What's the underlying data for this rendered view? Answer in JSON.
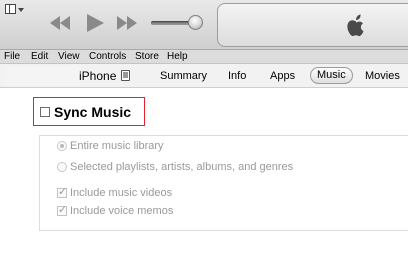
{
  "menu": {
    "items": [
      "File",
      "Edit",
      "View",
      "Controls",
      "Store",
      "Help"
    ]
  },
  "device": {
    "name": "iPhone",
    "icon": "iphone-icon"
  },
  "tabs": [
    {
      "label": "Summary",
      "active": false
    },
    {
      "label": "Info",
      "active": false
    },
    {
      "label": "Apps",
      "active": false
    },
    {
      "label": "Music",
      "active": true
    },
    {
      "label": "Movies",
      "active": false
    }
  ],
  "sync_music": {
    "label": "Sync Music",
    "checked": false
  },
  "library_options": [
    {
      "label": "Entire music library",
      "selected": true,
      "enabled": false
    },
    {
      "label": "Selected playlists, artists, albums, and genres",
      "selected": false,
      "enabled": false
    }
  ],
  "include_options": [
    {
      "label": "Include music videos",
      "checked": true,
      "enabled": false
    },
    {
      "label": "Include voice memos",
      "checked": true,
      "enabled": false
    }
  ],
  "colors": {
    "highlight": "#e8202a",
    "toolbar": "#d9d9d9",
    "disabled_text": "#9a9a9a"
  },
  "icons": [
    "sidebar-toggle-icon",
    "previous-track-icon",
    "play-icon",
    "next-track-icon",
    "volume-slider",
    "apple-logo-icon",
    "iphone-icon"
  ]
}
